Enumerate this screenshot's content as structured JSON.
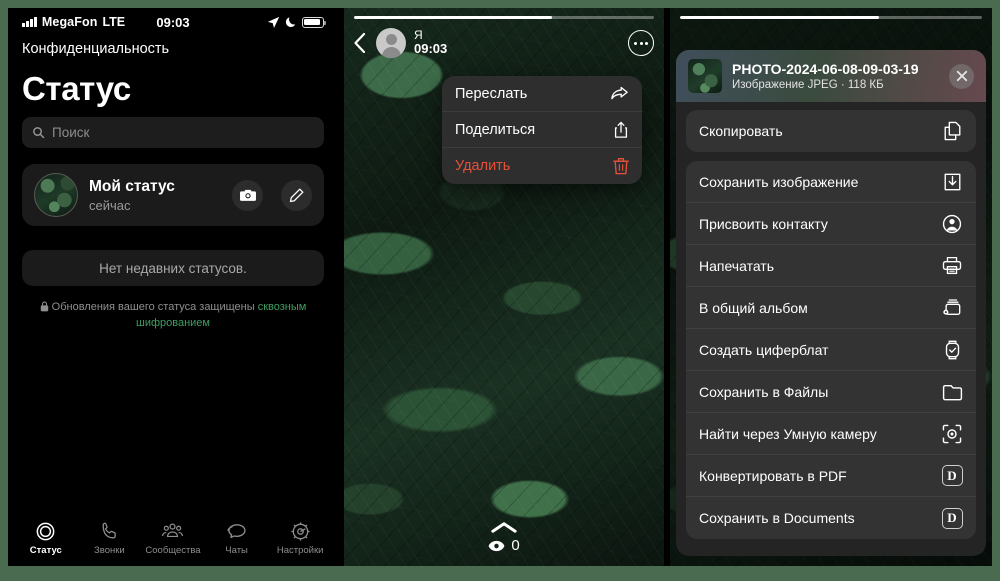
{
  "theme": {
    "frame_green": "#4a6b4f",
    "panel_black": "#000000",
    "card_gray": "#1b1b1b",
    "menu_gray": "#2e2e2e",
    "sheet_gray": "#333333",
    "accent_green": "#3f9e63",
    "danger_red": "#e8503a"
  },
  "status_panel": {
    "statusbar": {
      "carrier": "MegaFon",
      "network": "LTE",
      "time": "09:03",
      "icons": [
        "signal-bars-icon",
        "location-arrow-icon",
        "moon-icon",
        "battery-icon"
      ]
    },
    "back_label": "Конфиденциальность",
    "title": "Статус",
    "search": {
      "placeholder": "Поиск",
      "value": ""
    },
    "my_status": {
      "title": "Мой статус",
      "subtitle": "сейчас",
      "camera_button": "camera-icon",
      "edit_button": "pencil-icon"
    },
    "empty_state": "Нет недавних статусов.",
    "e2e_note_prefix": "Обновления вашего статуса защищены ",
    "e2e_note_link": "сквозным шифрованием",
    "tabs": [
      {
        "label": "Статус",
        "icon": "status-rings-icon",
        "active": true
      },
      {
        "label": "Звонки",
        "icon": "phone-icon",
        "active": false
      },
      {
        "label": "Сообщества",
        "icon": "communities-icon",
        "active": false
      },
      {
        "label": "Чаты",
        "icon": "chat-bubbles-icon",
        "active": false
      },
      {
        "label": "Настройки",
        "icon": "gear-icon",
        "active": false
      }
    ]
  },
  "story_panel": {
    "progress_percent": 66,
    "author": "Я",
    "time": "09:03",
    "back_icon": "chevron-left-icon",
    "more_icon": "more-dots-icon",
    "context_menu": [
      {
        "label": "Переслать",
        "icon": "forward-arrow-icon",
        "danger": false
      },
      {
        "label": "Поделиться",
        "icon": "share-up-icon",
        "danger": false
      },
      {
        "label": "Удалить",
        "icon": "trash-icon",
        "danger": true
      }
    ],
    "view_count": "0",
    "view_icon": "eye-icon",
    "swipe_up_icon": "chevron-up-icon"
  },
  "share_sheet": {
    "file_name": "PHOTO-2024-06-08-09-03-19",
    "file_meta": "Изображение JPEG · 118 КБ",
    "close_icon": "close-icon",
    "groups": [
      [
        {
          "label": "Скопировать",
          "icon": "copy-icon"
        }
      ],
      [
        {
          "label": "Сохранить изображение",
          "icon": "save-image-icon"
        },
        {
          "label": "Присвоить контакту",
          "icon": "contact-icon"
        },
        {
          "label": "Напечатать",
          "icon": "printer-icon"
        },
        {
          "label": "В общий альбом",
          "icon": "shared-album-icon"
        },
        {
          "label": "Создать циферблат",
          "icon": "watch-face-icon"
        },
        {
          "label": "Сохранить в Файлы",
          "icon": "folder-icon"
        },
        {
          "label": "Найти через Умную камеру",
          "icon": "visual-lookup-icon"
        },
        {
          "label": "Конвертировать в PDF",
          "icon": "documents-app-icon",
          "glyph": "D"
        },
        {
          "label": "Сохранить в Documents",
          "icon": "documents-app-icon",
          "glyph": "D"
        }
      ]
    ]
  }
}
